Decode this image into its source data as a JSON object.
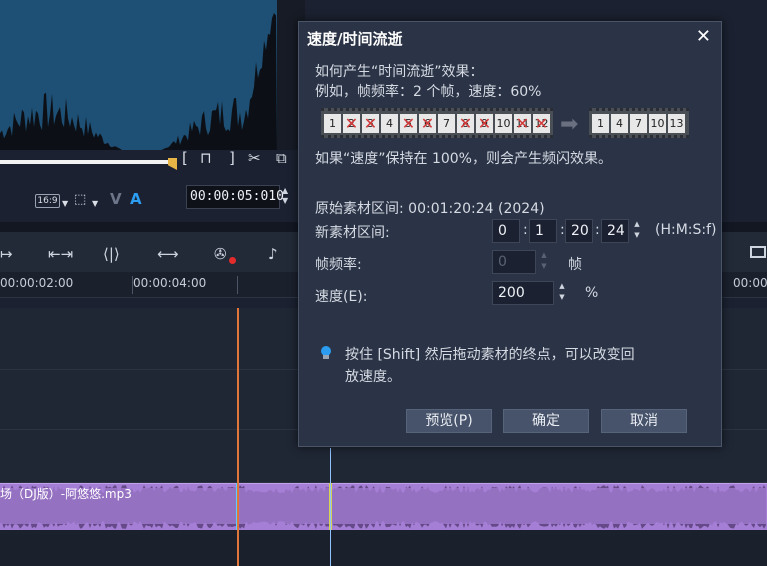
{
  "editor": {
    "aspect_label": "16:9",
    "timecode": "00:00:05:010",
    "ruler": {
      "ticks": [
        "00:00:02:00",
        "00:00:04:00",
        "00:00"
      ]
    },
    "audio_clip": {
      "name": "场（DJ版）-阿悠悠.mp3"
    },
    "icons": {
      "v": "V",
      "a": "A"
    }
  },
  "dialog": {
    "title": "速度/时间流逝",
    "how_heading": "如何产生“时间流逝”效果：",
    "example": "例如，帧频率：2 个帧，速度：60%",
    "flicker_note": "如果“速度”保持在 100%，则会产生频闪效果。",
    "original_duration": "原始素材区间: 00:01:20:24 (2024)",
    "new_duration_label": "新素材区间:",
    "new_duration": {
      "h": "0",
      "m": "1",
      "s": "20",
      "f": "24"
    },
    "hmsf_hint": "(H:M:S:f)",
    "frame_rate_label": "帧频率:",
    "frame_rate_value": "0",
    "frame_unit": "帧",
    "speed_label": "速度(E):",
    "speed_value": "200",
    "speed_unit": "%",
    "tip_line1": "按住 [Shift] 然后拖动素材的终点，可以改变回",
    "tip_line2": "放速度。",
    "buttons": {
      "preview": "预览(P)",
      "ok": "确定",
      "cancel": "取消"
    },
    "film_before": [
      {
        "n": "1",
        "x": false
      },
      {
        "n": "2",
        "x": true
      },
      {
        "n": "3",
        "x": true
      },
      {
        "n": "4",
        "x": false
      },
      {
        "n": "5",
        "x": true
      },
      {
        "n": "6",
        "x": true
      },
      {
        "n": "7",
        "x": false
      },
      {
        "n": "8",
        "x": true
      },
      {
        "n": "9",
        "x": true
      },
      {
        "n": "10",
        "x": false
      },
      {
        "n": "11",
        "x": true
      },
      {
        "n": "12",
        "x": true
      }
    ],
    "film_after": [
      "1",
      "4",
      "7",
      "10",
      "13"
    ]
  },
  "colors": {
    "accent": "#2b9cf0",
    "audio": "#a57fd6",
    "playhead": "#e0763a"
  }
}
